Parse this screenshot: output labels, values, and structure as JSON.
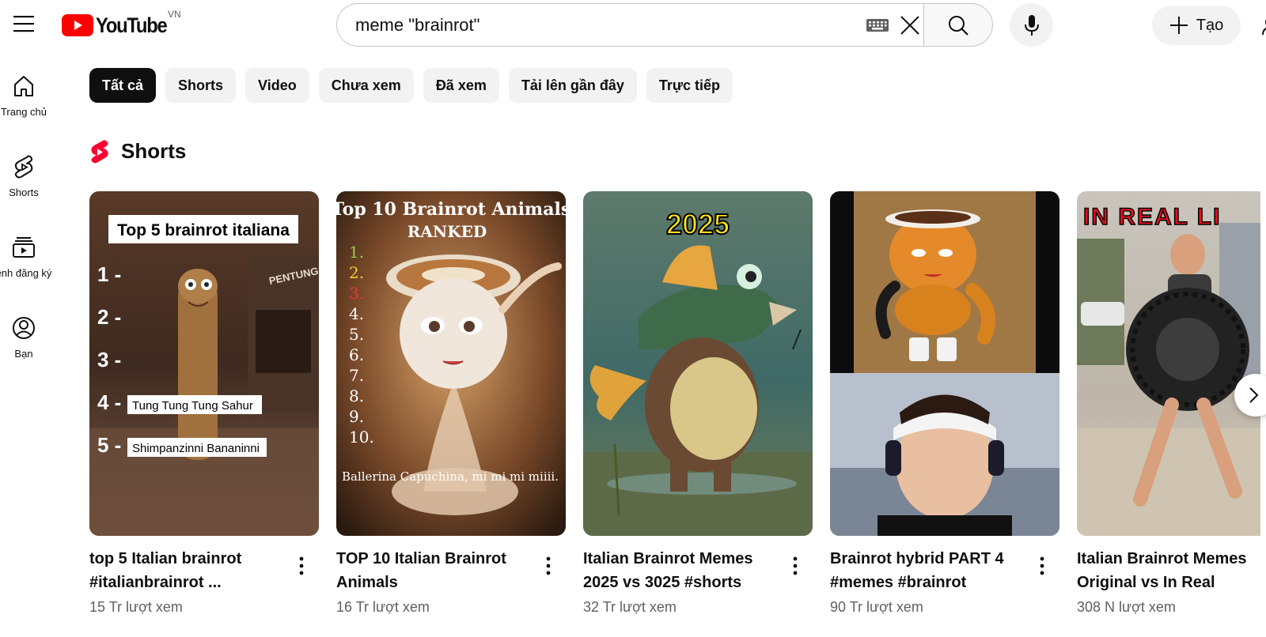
{
  "header": {
    "logo_text": "YouTube",
    "region": "VN",
    "search_value": "meme \"brainrot\"",
    "create_label": "Tạo",
    "icons": [
      "menu-icon",
      "youtube-logo-icon",
      "keyboard-icon",
      "close-icon",
      "search-icon",
      "mic-icon",
      "plus-icon"
    ]
  },
  "sidebar": {
    "items": [
      {
        "label": "Trang chủ",
        "icon": "home-icon"
      },
      {
        "label": "Shorts",
        "icon": "shorts-icon"
      },
      {
        "label": "ênh đăng ký",
        "icon": "subscriptions-icon"
      },
      {
        "label": "Bạn",
        "icon": "account-icon"
      }
    ]
  },
  "chips": [
    "Tất cả",
    "Shorts",
    "Video",
    "Chưa xem",
    "Đã xem",
    "Tải lên gần đây",
    "Trực tiếp"
  ],
  "section": {
    "title": "Shorts"
  },
  "shorts": [
    {
      "title": "top 5 Italian brainrot #italianbrainrot ...",
      "views": "15 Tr lượt xem",
      "overlay": {
        "heading": "Top 5 brainrot italiana",
        "nums": [
          "1 -",
          "2 -",
          "3 -",
          "4 -",
          "5 -"
        ],
        "item4": "Tung Tung Tung Sahur",
        "item5": "Shimpanzinni Bananinni",
        "sign": "PENTUNG POS RON"
      }
    },
    {
      "title": "TOP 10 Italian Brainrot Animals",
      "views": "16 Tr lượt xem",
      "overlay": {
        "heading1": "Top 10 Brainrot Animals",
        "heading2": "RANKED",
        "nums": [
          "1.",
          "2.",
          "3.",
          "4.",
          "5.",
          "6.",
          "7.",
          "8.",
          "9.",
          "10."
        ],
        "caption": "Ballerina Capuchina, mi mi mi miiii."
      }
    },
    {
      "title": "Italian Brainrot Memes 2025 vs 3025 #shorts",
      "views": "32 Tr lượt xem",
      "overlay": {
        "year": "2025"
      }
    },
    {
      "title": "Brainrot hybrid PART 4 #memes #brainrot",
      "views": "90 Tr lượt xem",
      "overlay": {}
    },
    {
      "title": "Italian Brainrot Memes Original vs In Real Life...",
      "views": "308 N lượt xem",
      "overlay": {
        "heading": "IN REAL LI"
      }
    }
  ],
  "colors": {
    "brand_red": "#ff0000",
    "chip_active": "#0f0f0f",
    "chip_bg": "#f2f2f2",
    "meta_text": "#606060"
  }
}
